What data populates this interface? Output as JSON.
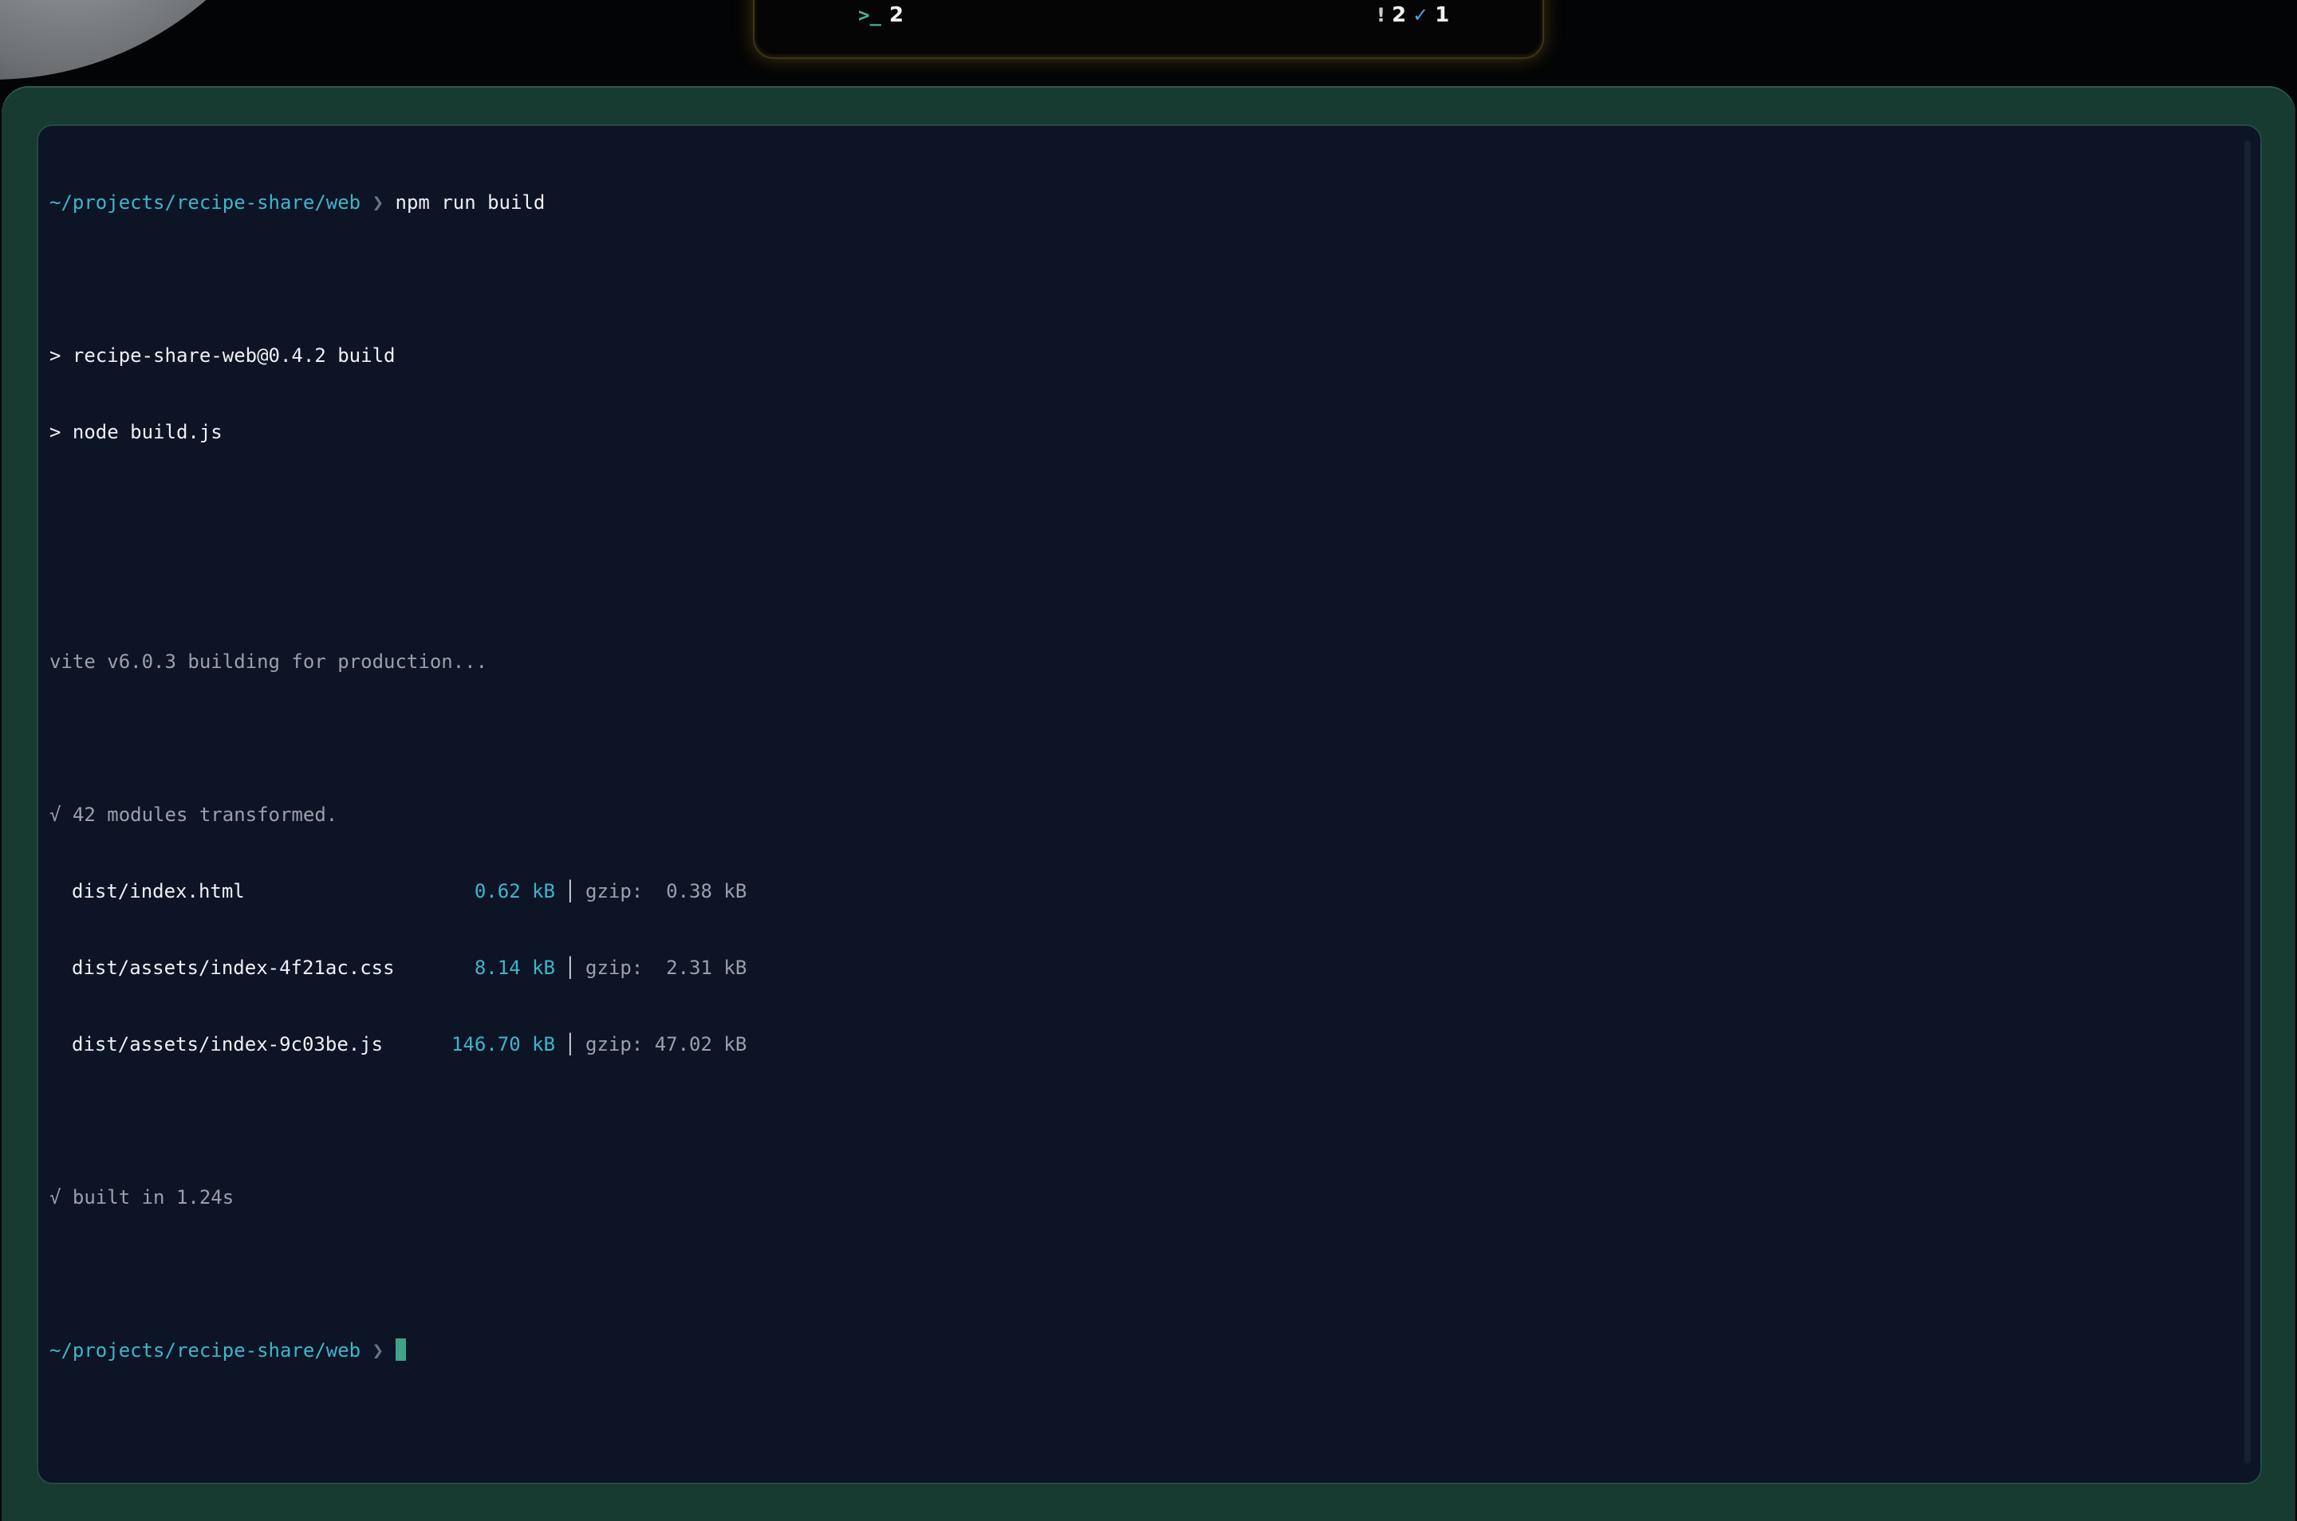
{
  "notch": {
    "terminal_icon": ">_",
    "terminal_count": "2",
    "warning_icon": "!",
    "warning_count": "2",
    "check_icon": "✓",
    "check_count": "1"
  },
  "terminal": {
    "prompt_path": "~/projects/recipe-share/web",
    "prompt_caret": "❯",
    "command": "npm run build",
    "script_line_1": "> recipe-share-web@0.4.2 build",
    "script_line_2": "> node build.js",
    "vite_line": "vite v6.0.3 building for production...",
    "transformed_line": "√ 42 modules transformed.",
    "outputs": [
      {
        "file": "dist/index.html",
        "size": "0.62 kB",
        "sep": "│",
        "gzip": "gzip:  0.38 kB"
      },
      {
        "file": "dist/assets/index-4f21ac.css",
        "size": "8.14 kB",
        "sep": "│",
        "gzip": "gzip:  2.31 kB"
      },
      {
        "file": "dist/assets/index-9c03be.js",
        "size": "146.70 kB",
        "sep": "│",
        "gzip": "gzip: 47.02 kB"
      }
    ],
    "built_line": "√ built in 1.24s",
    "final_prompt_path": "~/projects/recipe-share/web",
    "final_prompt_caret": "❯"
  },
  "colors": {
    "window_frame": "#173a31",
    "pane_background": "#0d1426",
    "path_accent": "#3fb5c9",
    "cursor": "#3fa389"
  }
}
